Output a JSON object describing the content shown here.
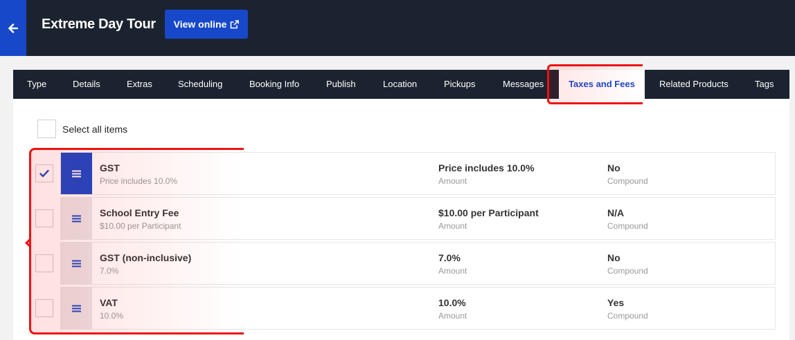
{
  "header": {
    "title": "Extreme Day Tour",
    "view_online_label": "View online",
    "accent_color": "#1748c9",
    "bar_color": "#1b2330"
  },
  "tabs": [
    {
      "label": "Type",
      "active": false
    },
    {
      "label": "Details",
      "active": false
    },
    {
      "label": "Extras",
      "active": false
    },
    {
      "label": "Scheduling",
      "active": false
    },
    {
      "label": "Booking Info",
      "active": false
    },
    {
      "label": "Publish",
      "active": false
    },
    {
      "label": "Location",
      "active": false
    },
    {
      "label": "Pickups",
      "active": false
    },
    {
      "label": "Messages",
      "active": false
    },
    {
      "label": "Taxes and Fees",
      "active": true
    },
    {
      "label": "Related Products",
      "active": false
    },
    {
      "label": "Tags",
      "active": false
    }
  ],
  "select_all_label": "Select all items",
  "items": [
    {
      "name": "GST",
      "description": "Price includes 10.0%",
      "amount": "Price includes 10.0%",
      "amount_label": "Amount",
      "compound": "No",
      "compound_label": "Compound",
      "checked": true
    },
    {
      "name": "School Entry Fee",
      "description": "$10.00 per Participant",
      "amount": "$10.00 per Participant",
      "amount_label": "Amount",
      "compound": "N/A",
      "compound_label": "Compound",
      "checked": false
    },
    {
      "name": "GST (non-inclusive)",
      "description": "7.0%",
      "amount": "7.0%",
      "amount_label": "Amount",
      "compound": "No",
      "compound_label": "Compound",
      "checked": false
    },
    {
      "name": "VAT",
      "description": "10.0%",
      "amount": "10.0%",
      "amount_label": "Amount",
      "compound": "Yes",
      "compound_label": "Compound",
      "checked": false
    }
  ],
  "icons": {
    "back": "arrow-left-icon",
    "external": "external-link-icon",
    "handle": "drag-handle-icon",
    "check": "checkmark-icon"
  }
}
